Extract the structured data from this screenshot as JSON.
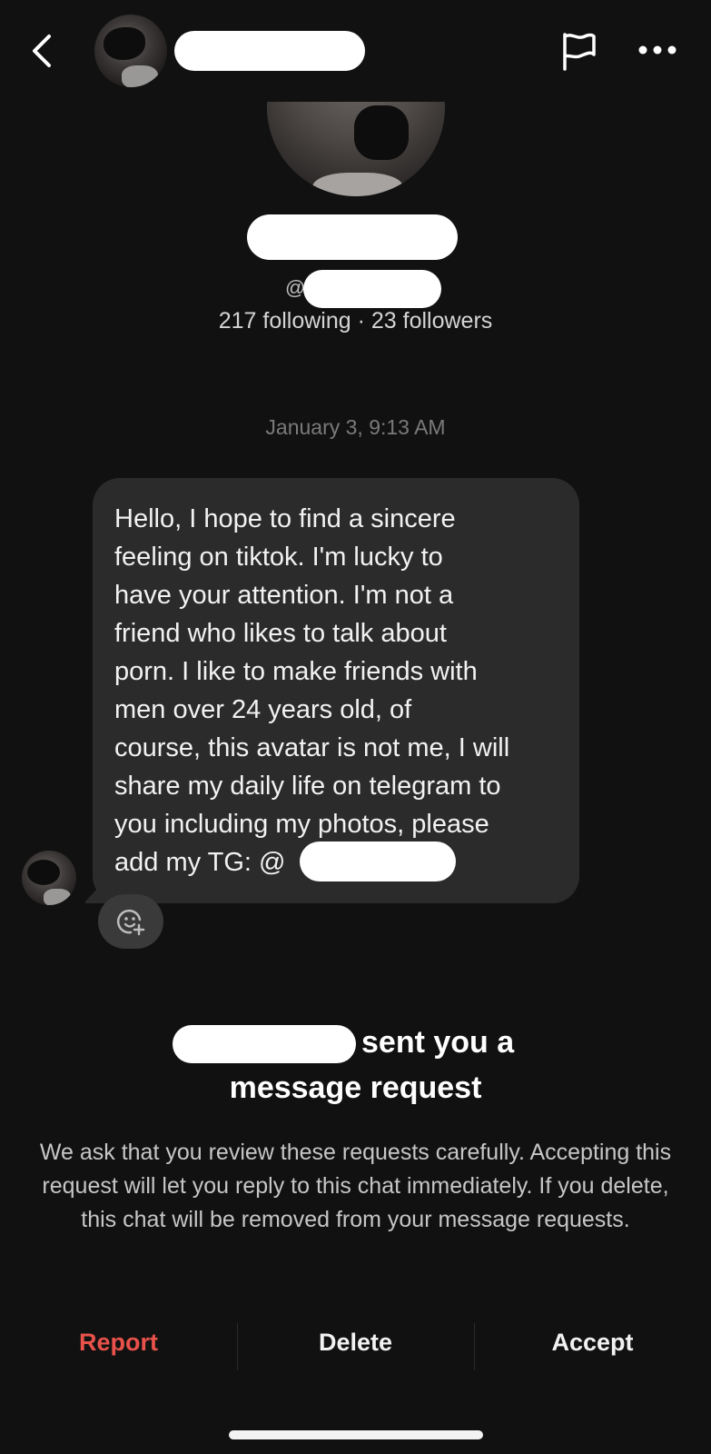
{
  "profile": {
    "handle_prefix": "@",
    "stats": "217 following · 23 followers"
  },
  "chat": {
    "timestamp": "January 3, 9:13 AM",
    "message": "Hello, I hope to find a sincere\nfeeling on tiktok. I'm lucky to\nhave your attention. I'm not a\nfriend who likes to talk about\nporn. I like to make friends with\nmen over 24 years old, of\ncourse, this avatar is not me, I will\nshare my daily life on telegram to\nyou including my photos, please\nadd my TG: @"
  },
  "request": {
    "line1": "sent you a",
    "line2": "message request",
    "body": "We ask that you review these requests carefully. Accepting this request will let you reply to this chat immediately. If you delete, this chat will be removed from your message requests."
  },
  "actions": {
    "report": "Report",
    "delete": "Delete",
    "accept": "Accept"
  },
  "colors": {
    "background": "#111111",
    "bubble": "#2b2b2b",
    "report": "#e8524a"
  },
  "icons": [
    "back-icon",
    "flag-icon",
    "more-icon",
    "add-reaction-icon"
  ]
}
